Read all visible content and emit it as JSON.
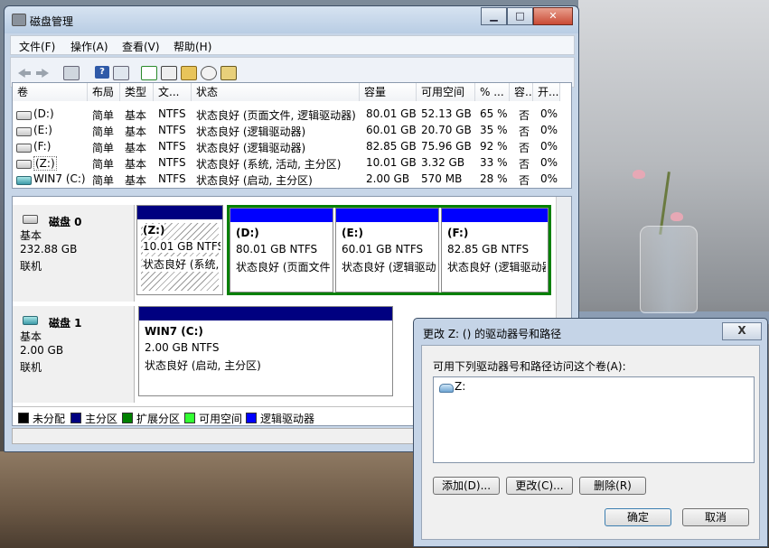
{
  "window": {
    "title": "磁盘管理"
  },
  "menu": [
    "文件(F)",
    "操作(A)",
    "查看(V)",
    "帮助(H)"
  ],
  "toolbar_icons": [
    "back-arrow-icon",
    "forward-arrow-icon",
    "volume-list-icon",
    "help-icon",
    "refresh-icon",
    "properties-icon",
    "open-folder-icon",
    "explore-icon",
    "settings-icon"
  ],
  "volume_table": {
    "headers": [
      "卷",
      "布局",
      "类型",
      "文...",
      "状态",
      "容量",
      "可用空间",
      "% ...",
      "容...",
      "开..."
    ],
    "rows": [
      [
        "(D:)",
        "简单",
        "基本",
        "NTFS",
        "状态良好 (页面文件, 逻辑驱动器)",
        "80.01 GB",
        "52.13 GB",
        "65 %",
        "否",
        "0%"
      ],
      [
        "(E:)",
        "简单",
        "基本",
        "NTFS",
        "状态良好 (逻辑驱动器)",
        "60.01 GB",
        "20.70 GB",
        "35 %",
        "否",
        "0%"
      ],
      [
        "(F:)",
        "简单",
        "基本",
        "NTFS",
        "状态良好 (逻辑驱动器)",
        "82.85 GB",
        "75.96 GB",
        "92 %",
        "否",
        "0%"
      ],
      [
        "(Z:)",
        "简单",
        "基本",
        "NTFS",
        "状态良好 (系统, 活动, 主分区)",
        "10.01 GB",
        "3.32 GB",
        "33 %",
        "否",
        "0%"
      ],
      [
        "WIN7 (C:)",
        "简单",
        "基本",
        "NTFS",
        "状态良好 (启动, 主分区)",
        "2.00 GB",
        "570 MB",
        "28 %",
        "否",
        "0%"
      ]
    ]
  },
  "disks": [
    {
      "name": "磁盘 0",
      "type": "基本",
      "size": "232.88 GB",
      "state": "联机",
      "partitions": [
        {
          "label": "(Z:)",
          "size": "10.01 GB NTFS",
          "status": "状态良好 (系统, 活动, 主分区)"
        },
        {
          "label": "(D:)",
          "size": "80.01 GB NTFS",
          "status": "状态良好 (页面文件, 逻辑驱动器)"
        },
        {
          "label": "(E:)",
          "size": "60.01 GB NTFS",
          "status": "状态良好 (逻辑驱动器)"
        },
        {
          "label": "(F:)",
          "size": "82.85 GB NTFS",
          "status": "状态良好 (逻辑驱动器)"
        }
      ]
    },
    {
      "name": "磁盘 1",
      "type": "基本",
      "size": "2.00 GB",
      "state": "联机",
      "partitions": [
        {
          "label": "WIN7  (C:)",
          "size": "2.00 GB NTFS",
          "status": "状态良好 (启动, 主分区)"
        }
      ]
    }
  ],
  "legend": [
    {
      "label": "未分配",
      "color": "#000000"
    },
    {
      "label": "主分区",
      "color": "#000080"
    },
    {
      "label": "扩展分区",
      "color": "#008000"
    },
    {
      "label": "可用空间",
      "color": "#33ff33"
    },
    {
      "label": "逻辑驱动器",
      "color": "#0000ff"
    }
  ],
  "dialog": {
    "title": "更改 Z: () 的驱动器号和路径",
    "close": "X",
    "label": "可用下列驱动器号和路径访问这个卷(A):",
    "items": [
      "Z:"
    ],
    "buttons": {
      "add": "添加(D)...",
      "change": "更改(C)...",
      "remove": "删除(R)",
      "ok": "确定",
      "cancel": "取消"
    }
  }
}
